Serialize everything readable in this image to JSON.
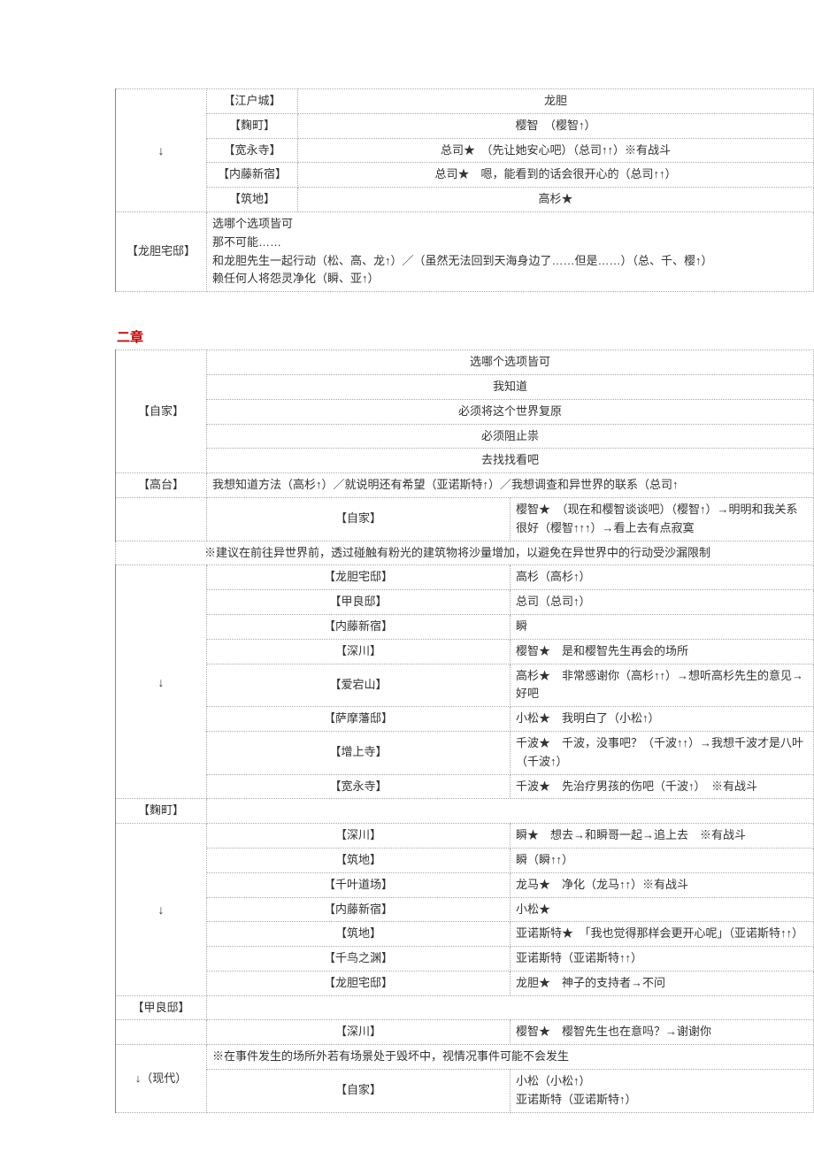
{
  "table1": {
    "rows": [
      {
        "col1": "↓",
        "col1_rowspan": 5,
        "col2": "【江户城】",
        "col3": "龙胆",
        "col3_center": true
      },
      {
        "col2": "【麴町】",
        "col3": "樱智　（樱智↑）",
        "col3_center": true
      },
      {
        "col2": "【宽永寺】",
        "col3": "总司★　（先让她安心吧）（总司↑↑）※有战斗",
        "col3_center": true
      },
      {
        "col2": "【内藤新宿】",
        "col3": "总司★　嗯，能看到的话会很开心的（总司↑↑）",
        "col3_center": true
      },
      {
        "col2": "【筑地】",
        "col3": "高杉★",
        "col3_center": true
      },
      {
        "col1": "【龙胆宅邸】",
        "col1_rowspan": 1,
        "col2_span": true,
        "col3": "选哪个选项皆可\n那不可能……\n和龙胆先生一起行动（松、高、龙↑）／（虽然无法回到天海身边了……但是……）（总、千、樱↑）\n赖任何人将怨灵净化（瞬、亚↑）"
      }
    ]
  },
  "chapter_title": "二章",
  "table2": {
    "intro_col1": "【自家】",
    "intro_lines": [
      "选哪个选项皆可",
      "我知道",
      "必须将这个世界复原",
      "必须阻止祟",
      "去找找看吧"
    ],
    "gaotai_col1": "【高台】",
    "gaotai_text": "我想知道方法（高杉↑）／就说明还有希望（亚诺斯特↑）／我想调查和异世界的联系（总司↑",
    "jike_col2": "【自家】",
    "jike_text": "樱智★　（现在和樱智谈谈吧）（樱智↑）→明明和我关系很好（樱智↑↑↑）→看上去有点寂寞",
    "note1": "※建议在前往异世界前，透过碰触有粉光的建筑物将沙量增加，以避免在异世界中的行动受沙漏限制",
    "group1": [
      {
        "col2": "【龙胆宅邸】",
        "col3": "高杉（高杉↑）"
      },
      {
        "col2": "【甲良邸】",
        "col3": "总司（总司↑）"
      },
      {
        "col2": "【内藤新宿】",
        "col3": "瞬"
      },
      {
        "col2": "【深川】",
        "col3": "樱智★　是和樱智先生再会的场所"
      },
      {
        "col2": "【爱宕山】",
        "col3": "高杉★　非常感谢你（高杉↑↑）→想听高杉先生的意见→好吧"
      },
      {
        "col2": "【萨摩藩邸】",
        "col3": "小松★　我明白了（小松↑）"
      },
      {
        "col2": "【增上寺】",
        "col3": "千波★　千波，没事吧？（千波↑↑）→我想千波才是八叶（千波↑）"
      },
      {
        "col2": "【宽永寺】",
        "col3": "千波★　先治疗男孩的伤吧（千波↑）　※有战斗"
      }
    ],
    "koji_col1": "【麴町】",
    "group2": [
      {
        "col2": "【深川】",
        "col3": "瞬★　想去→和瞬哥一起→追上去　※有战斗"
      },
      {
        "col2": "【筑地】",
        "col3": "瞬（瞬↑↑）"
      },
      {
        "col2": "【千叶道场】",
        "col3": "龙马★　净化（龙马↑↑）※有战斗"
      },
      {
        "col2": "【内藤新宿】",
        "col3": "小松★"
      },
      {
        "col2": "【筑地】",
        "col3": "亚诺斯特★　「我也觉得那样会更开心呢」（亚诺斯特↑↑）"
      },
      {
        "col2": "【千鸟之渊】",
        "col3": "亚诺斯特（亚诺斯特↑↑）"
      },
      {
        "col2": "【龙胆宅邸】",
        "col3": "龙胆★　神子的支持者→不问"
      }
    ],
    "jiali_col1": "【甲良邸】",
    "shenkawa_col2": "【深川】",
    "shenkawa_text": "樱智★　樱智先生也在意吗？→谢谢你",
    "note2": "※在事件发生的场所外若有场景处于毁坏中，视情况事件可能不会发生",
    "xiandai_col1": "↓（现代）",
    "xiandai_col2": "【自家】",
    "xiandai_lines": "小松（小松↑）\n亚诺斯特（亚诺斯特↑）"
  }
}
